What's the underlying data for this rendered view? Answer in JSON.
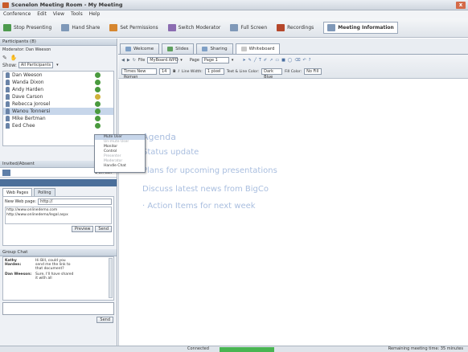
{
  "window": {
    "title": "Scenelon Meeting Room - My Meeting",
    "close_glyph": "x"
  },
  "menu": [
    "Conference",
    "Edit",
    "View",
    "Tools",
    "Help"
  ],
  "toolbar": [
    {
      "label": "Stop Presenting",
      "icon": "stop-icon"
    },
    {
      "label": "Hand Share",
      "icon": "hand-icon"
    },
    {
      "label": "Set Permissions",
      "icon": "permissions-icon"
    },
    {
      "label": "Switch Moderator",
      "icon": "switch-icon"
    },
    {
      "label": "Full Screen",
      "icon": "fullscreen-icon"
    },
    {
      "label": "Recordings",
      "icon": "record-icon"
    },
    {
      "label": "Meeting Information",
      "icon": "info-icon"
    }
  ],
  "participants": {
    "header": "Participants (8)",
    "moderator": "Moderator: Dan Weeson",
    "show_label": "Show:",
    "show_value": "All Participants",
    "people": [
      {
        "name": "Dan Weeson",
        "status": "green"
      },
      {
        "name": "Wanda Dixon",
        "status": "green"
      },
      {
        "name": "Andy Harden",
        "status": "green"
      },
      {
        "name": "Dave Carson",
        "status": "yellow"
      },
      {
        "name": "Rebecca Jorosel",
        "status": "green"
      },
      {
        "name": "Wanou Tonnersi",
        "status": "green"
      },
      {
        "name": "Mike Bertman",
        "status": "green"
      },
      {
        "name": "Eed Chee",
        "status": "green"
      }
    ]
  },
  "context_menu": [
    {
      "label": "Mute User",
      "state": "highlight"
    },
    {
      "label": "Un-mute User",
      "state": "disabled"
    },
    {
      "label": "Monitor",
      "state": "normal"
    },
    {
      "label": "Control",
      "state": "normal"
    },
    {
      "label": "Presenter",
      "state": "disabled"
    },
    {
      "label": "Moderator",
      "state": "disabled"
    },
    {
      "label": "Handle Chat",
      "state": "normal"
    }
  ],
  "invite": {
    "header": "Invited/Absent",
    "tooltip": "1 on call"
  },
  "web": {
    "tabs": [
      "Web Pages",
      "Polling"
    ],
    "page_label": "New Web page:",
    "page_value": "http://",
    "urls": [
      "http://www.onlinedemo.com",
      "http://www.onlinedemo/legal.aspx"
    ],
    "preview_label": "Preview",
    "send_label": "Send"
  },
  "chat": {
    "header": "Group Chat",
    "messages": [
      {
        "from": "Kathy Harden:",
        "text": "Hi Bill, could you send me the link to that document?"
      },
      {
        "from": "Dan Weeson:",
        "text": "Sure, I'll have shared it with all"
      }
    ],
    "send_label": "Send"
  },
  "tabs": [
    {
      "label": "Welcome",
      "icon": "welcome-icon"
    },
    {
      "label": "Slides",
      "icon": "slides-icon"
    },
    {
      "label": "Sharing",
      "icon": "sharing-icon"
    },
    {
      "label": "Whiteboard",
      "icon": "whiteboard-icon",
      "active": true
    }
  ],
  "wb": {
    "file_label": "File",
    "file_value": "MyBoard.WPD",
    "page_label": "Page",
    "page_value": "Page 1",
    "font_value": "Times New Roman",
    "size_value": "14",
    "bold": "B",
    "italic": "I",
    "line_label": "Line Width:",
    "line_value": "1 pixel",
    "line_color_label": "Text & Line Color:",
    "line_color_value": "Dark Blue",
    "fill_label": "Fill Color:",
    "fill_value": "No Fill"
  },
  "agenda": {
    "title": "Agenda",
    "items": [
      "Status update",
      "Plans for upcoming presentations",
      "Discuss latest news from BigCo",
      "· Action Items for next week"
    ]
  },
  "status": {
    "left": "Connected",
    "right": "Remaining meeting time: 35 minutes"
  }
}
